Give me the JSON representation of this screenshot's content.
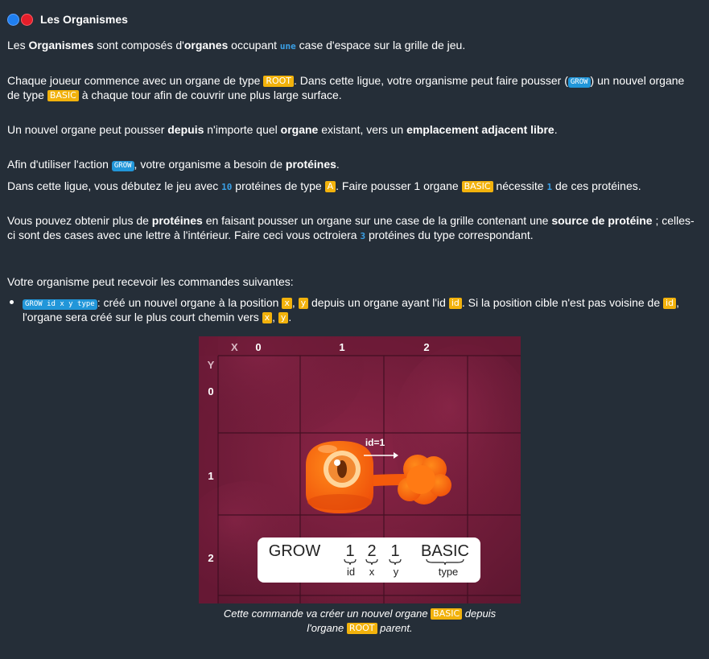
{
  "header": {
    "title": "Les Organismes"
  },
  "p1": {
    "a": "Les ",
    "b1": "Organismes",
    "c": " sont composés d'",
    "b2": "organes",
    "d": " occupant ",
    "une": "une",
    "e": " case d'espace sur la grille de jeu."
  },
  "p2": {
    "a": "Chaque joueur commence avec un organe de type ",
    "root": "ROOT",
    "b": ". Dans cette ligue, votre organisme peut faire pousser (",
    "grow": "GROW",
    "c": ") un nouvel organe de type ",
    "basic": "BASIC",
    "d": " à chaque tour afin de couvrir une plus large surface."
  },
  "p3": {
    "a": "Un nouvel organe peut pousser ",
    "b1": "depuis",
    "c": " n'importe quel ",
    "b2": "organe",
    "d": " existant, vers un ",
    "b3": "emplacement adjacent libre",
    "e": "."
  },
  "p4": {
    "a": "Afin d'utiliser l'action ",
    "grow": "GROW",
    "b": ", votre organisme a besoin de ",
    "b1": "protéines",
    "c": "."
  },
  "p5": {
    "a": "Dans cette ligue, vous débutez le jeu avec ",
    "n1": "10",
    "b": " protéines de type ",
    "kA": "A",
    "c": ". Faire pousser 1 organe ",
    "basic": "BASIC",
    "d": " nécessite ",
    "n2": "1",
    "e": " de ces protéines."
  },
  "p6": {
    "a": "Vous pouvez obtenir plus de ",
    "b1": "protéines",
    "b": " en faisant pousser un organe sur une case de la grille contenant une ",
    "b2": "source de protéine",
    "c": " ; celles-ci sont des cases avec une lettre à l'intérieur. Faire ceci vous octroiera ",
    "n": "3",
    "d": " protéines du type correspondant."
  },
  "p7": {
    "text": "Votre organisme peut recevoir les commandes suivantes:"
  },
  "bullet": {
    "cmd": "GROW id x y type",
    "a": ": créé un nouvel organe à la position ",
    "x": "x",
    "comma1": ", ",
    "y": "y",
    "b": " depuis un organe ayant l'id ",
    "id1": "id",
    "c": ". Si la position cible n'est pas voisine de ",
    "id2": "id",
    "d": ", l'organe sera créé sur le plus court chemin vers ",
    "x2": "x",
    "comma2": ", ",
    "y2": "y",
    "e": "."
  },
  "diagram": {
    "x_axis": "X",
    "y_axis": "Y",
    "col_labels": [
      "0",
      "1",
      "2"
    ],
    "row_labels": [
      "0",
      "1",
      "2"
    ],
    "id_label": "id=1",
    "command": {
      "word": "GROW",
      "v1": "1",
      "v2": "2",
      "v3": "1",
      "type": "BASIC",
      "s1": "id",
      "s2": "x",
      "s3": "y",
      "s4": "type"
    }
  },
  "caption": {
    "a": "Cette commande va créer un nouvel organe ",
    "basic": "BASIC",
    "b": " depuis",
    "c": "l'organe ",
    "root": "ROOT",
    "d": " parent."
  },
  "colors": {
    "background": "#252e38",
    "keyword": "#f2b20c",
    "keyword_blue": "#2196d9",
    "number": "#3aa0e6",
    "organ": "#ff6a00",
    "board": "#7a1f3e"
  }
}
